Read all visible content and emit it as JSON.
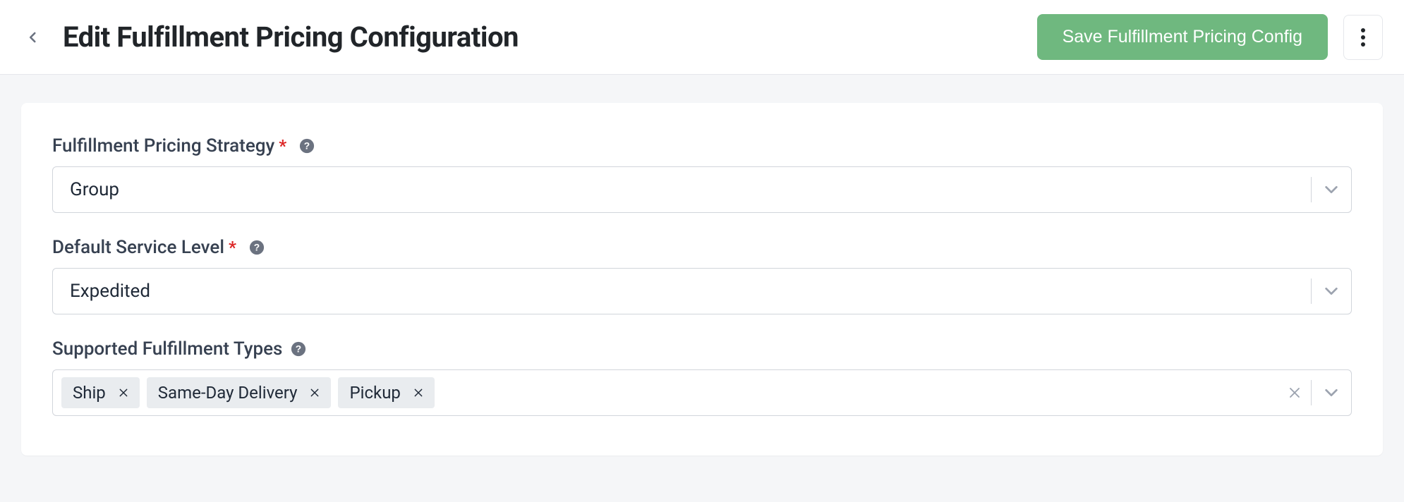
{
  "header": {
    "title": "Edit Fulfillment Pricing Configuration",
    "save_label": "Save Fulfillment Pricing Config"
  },
  "form": {
    "strategy": {
      "label": "Fulfillment Pricing Strategy",
      "required": true,
      "value": "Group"
    },
    "service_level": {
      "label": "Default Service Level",
      "required": true,
      "value": "Expedited"
    },
    "fulfillment_types": {
      "label": "Supported Fulfillment Types",
      "required": false,
      "values": [
        "Ship",
        "Same-Day Delivery",
        "Pickup"
      ]
    }
  }
}
